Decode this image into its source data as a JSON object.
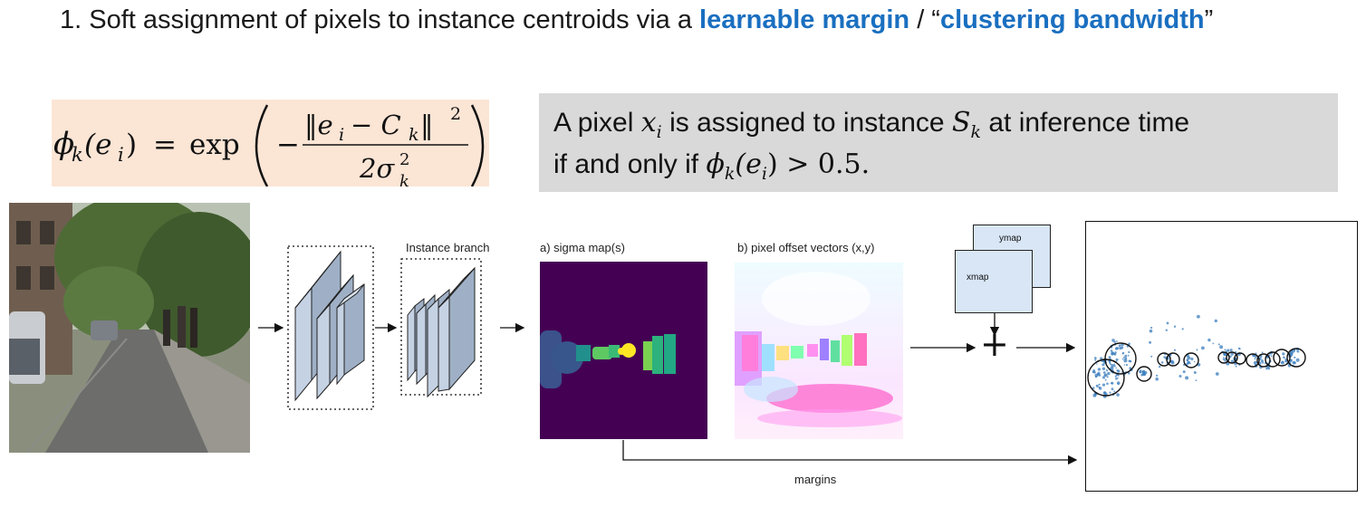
{
  "title": {
    "prefix": "1. Soft assignment of pixels to instance centroids via a ",
    "highlight1": "learnable margin",
    "middle": " / “",
    "highlight2": "clustering bandwidth",
    "suffix": "”"
  },
  "equation": {
    "lhs": "ϕ",
    "lhs_sub": "k",
    "lhs_arg": "(e",
    "lhs_arg_sub": "i",
    "lhs_close": ")",
    "equals": "=",
    "func": "exp",
    "numerator": "‖e",
    "num_sub_i": "i",
    "num_minus": "− C",
    "num_sub_k": "k",
    "num_close": "‖",
    "num_sup": "2",
    "denominator": "2σ",
    "den_sup": "2",
    "den_sub": "k"
  },
  "rule": {
    "line1_a": "A pixel ",
    "line1_x": "x",
    "line1_xsub": "i",
    "line1_b": " is assigned to instance ",
    "line1_s": "S",
    "line1_ssub": "k",
    "line1_c": " at inference time",
    "line2_a": "if and only if ",
    "line2_phi": "ϕ",
    "line2_phisub": "k",
    "line2_arg": "(e",
    "line2_argsub": "i",
    "line2_end": ") > 0.5."
  },
  "diagram": {
    "instance_branch_label": "Instance branch",
    "sigma_label": "a)  sigma map(s)",
    "offset_label": "b) pixel offset vectors (x,y)",
    "ymap_label": "ymap",
    "xmap_label": "xmap",
    "plus_label": "+",
    "margins_label": "margins"
  },
  "colors": {
    "highlight": "#1a6fc0",
    "equation_bg": "#fbe5d5",
    "rule_bg": "#d9d9d9",
    "sigma_bg": "#440154",
    "layer_fill": "#b8c6d8",
    "map_fill": "#d8e6f6",
    "scatter_points": "#3b7dbd"
  }
}
